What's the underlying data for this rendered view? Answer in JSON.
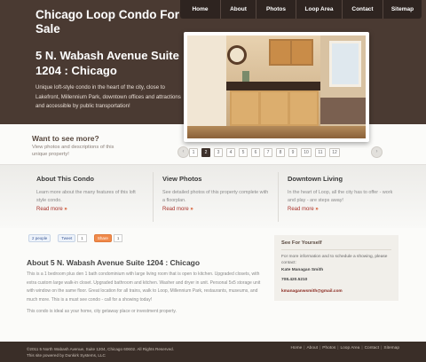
{
  "site_title": "Chicago Loop Condo For Sale",
  "nav": [
    "Home",
    "About",
    "Photos",
    "Loop Area",
    "Contact",
    "Sitemap"
  ],
  "hero": {
    "title": "5 N. Wabash Avenue Suite 1204 : Chicago",
    "description": "Unique loft-style condo in the heart of the city, close to Lakefront, Millennium Park, downtown offices and attractions and accessible by public transportation!"
  },
  "slider": {
    "title": "Want to see more?",
    "subtitle": "View photos and descriptions of this unique property!",
    "pages": [
      "1",
      "2",
      "3",
      "4",
      "5",
      "6",
      "7",
      "8",
      "9",
      "10",
      "11",
      "12"
    ],
    "active_page": "2",
    "prev_arrow": "‹",
    "next_arrow": "›"
  },
  "features": [
    {
      "title": "About This Condo",
      "text": "Learn more about the many features of this loft style condo.",
      "more": "Read more"
    },
    {
      "title": "View Photos",
      "text": "See detailed photos of this property complete with a floorplan.",
      "more": "Read more"
    },
    {
      "title": "Downtown Living",
      "text": "In the heart of Loop, all the city has to offer - work and play - are steps away!",
      "more": "Read more"
    }
  ],
  "share": {
    "google_label": "2 people",
    "tweet_label": "Tweet",
    "tweet_count": "1",
    "share_label": "Share",
    "share_count": "1"
  },
  "main": {
    "title": "About 5 N. Wabash Avenue Suite 1204 : Chicago",
    "body": "This is a 1 bedroom plus den 1 bath condominium with large living room that is open to kitchen. Upgraded closets, with extra custom large walk-in closet. Upgraded bathroom and kitchen. Washer and dryer in unit. Personal 5x5 storage unit with window on the same floor. Great location for all trains, walk to Loop, Millennium Park, restaurants, museums, and much more. This is a must see condo - call for a showing today!",
    "body2": "This condo is ideal as your home, city getaway place or investment property."
  },
  "sidebar": {
    "title": "See For Yourself",
    "text": "For more information and to schedule a showing, please contact:",
    "name": "Kate Managan Smith",
    "phone": "708.420.5210",
    "email": "kmanaganwsmith@gmail.com"
  },
  "footer": {
    "copyright": "©2011 5 North Wabash Avenue, Suite 1204, Chicago 60602. All Rights Reserved.",
    "designed_by": "This site powered by Dunkirk Systems, LLC",
    "links": [
      "Home",
      "About",
      "Photos",
      "Loop Area",
      "Contact",
      "Sitemap"
    ]
  },
  "colors": {
    "header_bg": "#4a3a32",
    "nav_bg": "#2e2420",
    "footer_bg": "#3a2e28",
    "link_red": "#a8322a"
  }
}
